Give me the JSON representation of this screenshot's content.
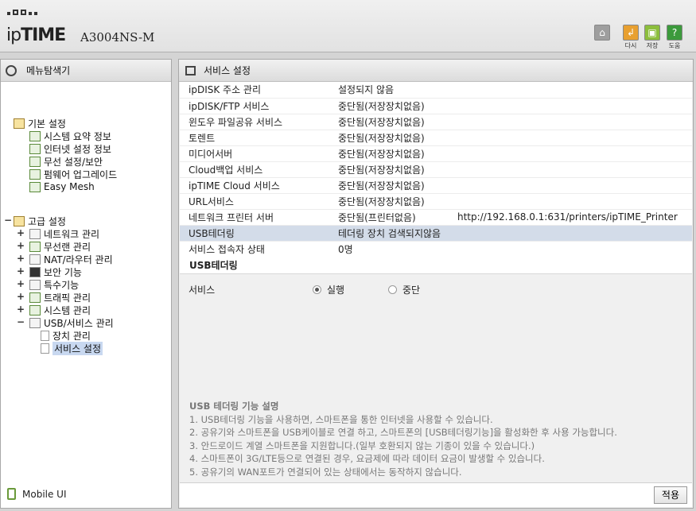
{
  "header": {
    "brand_prefix": "ip",
    "brand_bold": "TIME",
    "model": "A3004NS-M",
    "buttons": [
      {
        "icon": "home-icon",
        "label": "",
        "color": "#9e9e9e"
      },
      {
        "icon": "back-icon",
        "label": "다시",
        "color": "#e8a030"
      },
      {
        "icon": "save-icon",
        "label": "저장",
        "color": "#8cbe3c"
      },
      {
        "icon": "help-icon",
        "label": "도움",
        "color": "#3c9a3c"
      }
    ]
  },
  "sidebar": {
    "title": "메뉴탐색기",
    "basic": {
      "label": "기본 설정",
      "items": [
        "시스템 요약 정보",
        "인터넷 설정 정보",
        "무선 설정/보안",
        "펌웨어 업그레이드",
        "Easy Mesh"
      ]
    },
    "advanced": {
      "label": "고급 설정",
      "items": [
        "네트워크 관리",
        "무선랜 관리",
        "NAT/라우터 관리",
        "보안 기능",
        "특수기능",
        "트래픽 관리",
        "시스템 관리",
        "USB/서비스 관리"
      ],
      "usb_children": [
        "장치 관리",
        "서비스 설정"
      ]
    },
    "mobile_ui": "Mobile UI"
  },
  "main": {
    "title": "서비스 설정",
    "rows": [
      {
        "name": "ipDISK 주소 관리",
        "status": "설정되지 않음",
        "extra": ""
      },
      {
        "name": "ipDISK/FTP 서비스",
        "status": "중단됨(저장장치없음)",
        "extra": ""
      },
      {
        "name": "윈도우 파일공유 서비스",
        "status": "중단됨(저장장치없음)",
        "extra": ""
      },
      {
        "name": "토렌트",
        "status": "중단됨(저장장치없음)",
        "extra": ""
      },
      {
        "name": "미디어서버",
        "status": "중단됨(저장장치없음)",
        "extra": ""
      },
      {
        "name": "Cloud백업 서비스",
        "status": "중단됨(저장장치없음)",
        "extra": ""
      },
      {
        "name": "ipTIME Cloud 서비스",
        "status": "중단됨(저장장치없음)",
        "extra": ""
      },
      {
        "name": "URL서비스",
        "status": "중단됨(저장장치없음)",
        "extra": ""
      },
      {
        "name": "네트워크 프린터 서버",
        "status": "중단됨(프린터없음)",
        "extra": "http://192.168.0.1:631/printers/ipTIME_Printer"
      },
      {
        "name": "USB테더링",
        "status": "테더링 장치 검색되지않음",
        "extra": ""
      },
      {
        "name": "서비스 접속자 상태",
        "status": "0명",
        "extra": ""
      }
    ],
    "usb_section_title": "USB테더링",
    "service_label": "서비스",
    "radio_on": "실행",
    "radio_off": "중단",
    "desc_title": "USB 테더링 기능 설명",
    "desc_lines": [
      "1. USB테더링 기능을 사용하면, 스마트폰을 통한 인터넷을 사용할 수 있습니다.",
      "2. 공유기와 스마트폰을 USB케이블로 연결 하고, 스마트폰의 [USB테더링기능]을 활성화한 후 사용 가능합니다.",
      "3. 안드로이드 계열 스마트폰을 지원합니다.(일부 호환되지 않는 기종이 있을 수 있습니다.)",
      "4. 스마트폰이 3G/LTE등으로 연결된 경우, 요금제에 따라 데이터 요금이 발생할 수 있습니다.",
      "5. 공유기의 WAN포트가 연결되어 있는 상태에서는 동작하지 않습니다."
    ],
    "apply_label": "적용"
  }
}
